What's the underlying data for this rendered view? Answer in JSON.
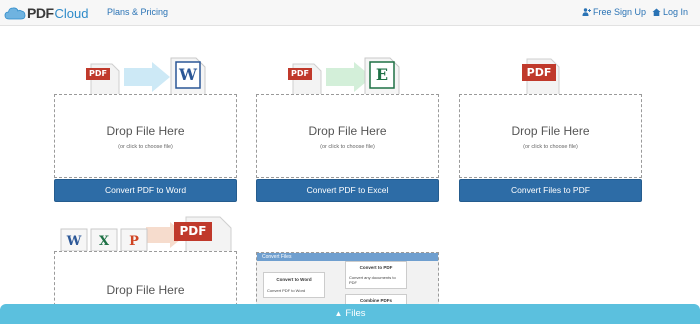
{
  "brand": {
    "pdf": "PDF",
    "cloud": "Cloud"
  },
  "nav": {
    "plans": "Plans & Pricing",
    "signup": "Free Sign Up",
    "login": "Log In"
  },
  "cards": [
    {
      "drop_title": "Drop File Here",
      "drop_sub": "(or click to choose file)",
      "button": "Convert PDF to Word",
      "tag": "PDF"
    },
    {
      "drop_title": "Drop File Here",
      "drop_sub": "(or click to choose file)",
      "button": "Convert PDF to Excel",
      "tag": "PDF"
    },
    {
      "drop_title": "Drop File Here",
      "drop_sub": "(or click to choose file)",
      "button": "Convert Files to PDF",
      "tag": "PDF"
    },
    {
      "drop_title": "Drop File Here",
      "tag": "PDF"
    }
  ],
  "preview": {
    "header": "Convert Files",
    "box1_title": "Convert to Word",
    "box1_text": "Convert PDF to Word",
    "box2_title": "Convert to PDF",
    "box2_text": "Convert any documents to PDF",
    "box3_title": "Combine PDFs"
  },
  "files_bar": "Files",
  "colors": {
    "accent": "#2d6ca6",
    "files_bar": "#5bc0de",
    "pdf_red": "#c0392b",
    "word_blue": "#2b5797",
    "excel_green": "#1e7145"
  }
}
